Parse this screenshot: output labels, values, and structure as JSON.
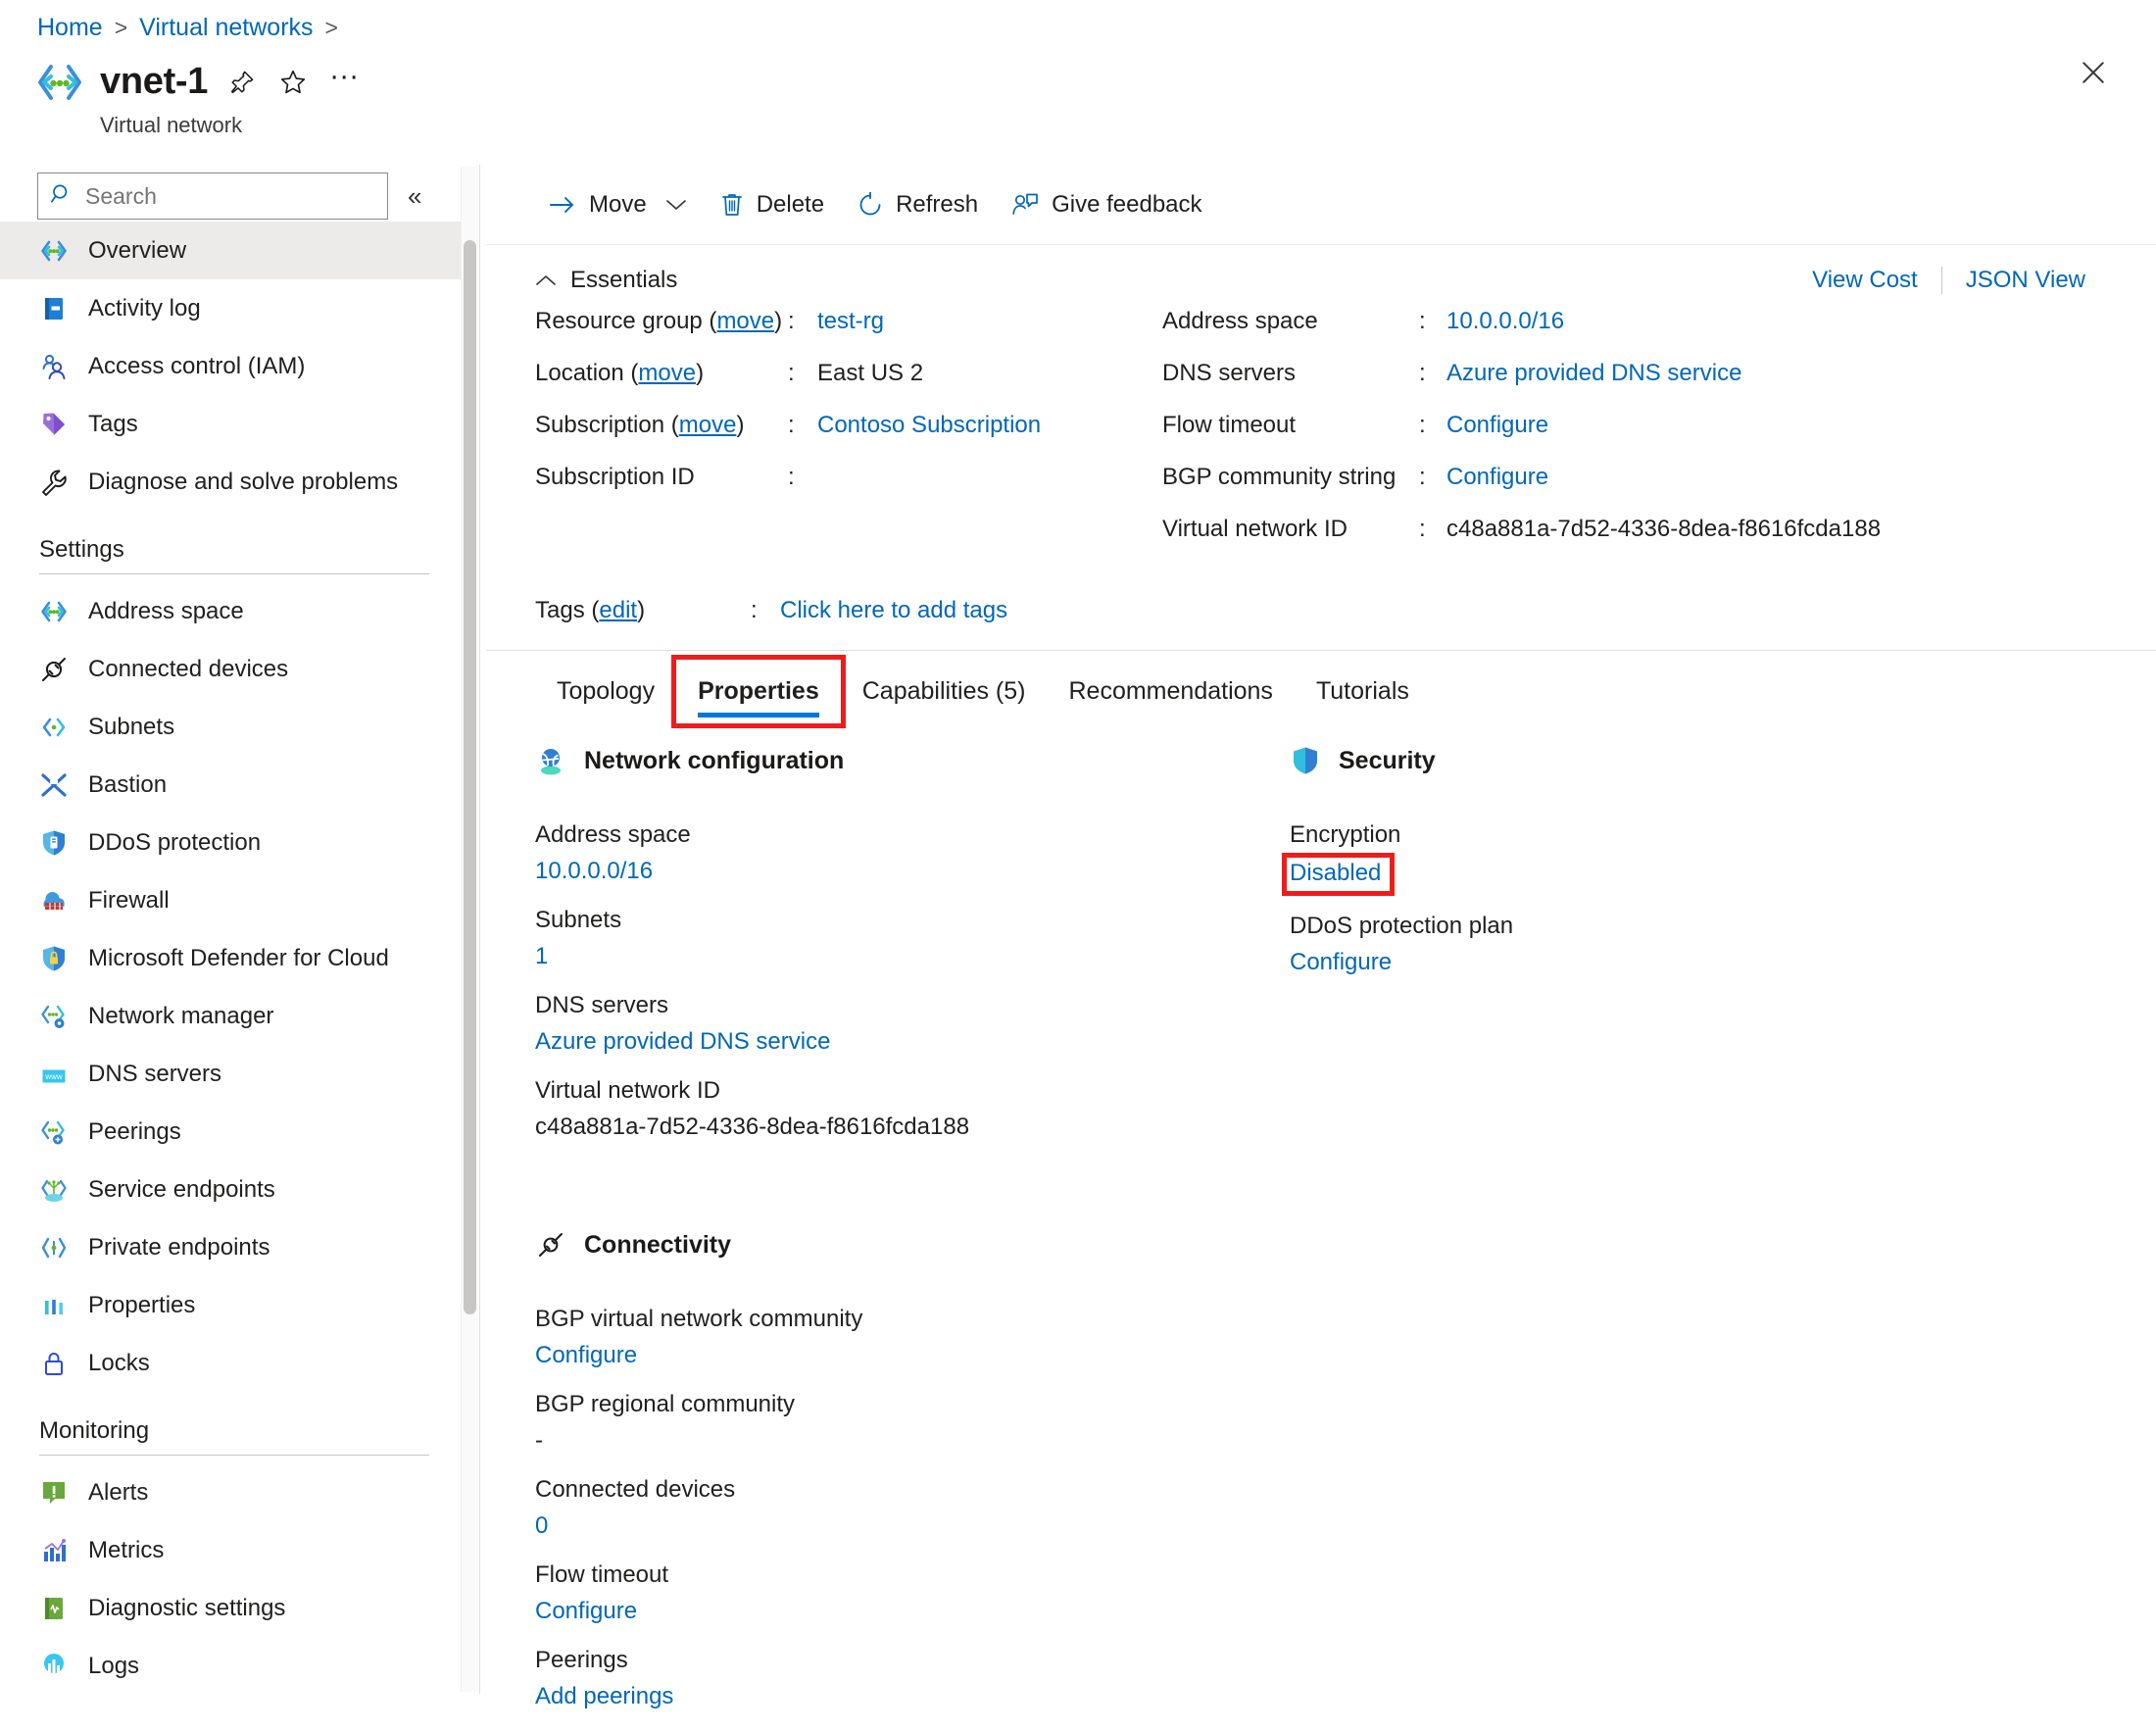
{
  "breadcrumb": {
    "items": [
      {
        "label": "Home",
        "sep": ">"
      },
      {
        "label": "Virtual networks",
        "sep": ">"
      }
    ]
  },
  "header": {
    "resource_name": "vnet-1",
    "resource_type": "Virtual network",
    "icon": "virtual-network-icon",
    "actions": {
      "pin": "pin-icon",
      "favorite": "star-icon",
      "more": "···",
      "close": "close-icon"
    }
  },
  "sidebar": {
    "search": {
      "placeholder": "Search",
      "value": "",
      "icon": "search-icon"
    },
    "collapse_label": "«",
    "items": [
      {
        "label": "Overview",
        "icon": "virtual-network-icon",
        "active": true,
        "kind": "item"
      },
      {
        "label": "Activity log",
        "icon": "activity-log-icon",
        "kind": "item"
      },
      {
        "label": "Access control (IAM)",
        "icon": "access-control-icon",
        "kind": "item"
      },
      {
        "label": "Tags",
        "icon": "tags-icon",
        "kind": "item"
      },
      {
        "label": "Diagnose and solve problems",
        "icon": "wrench-icon",
        "kind": "item"
      },
      {
        "label": "Settings",
        "kind": "group"
      },
      {
        "label": "Address space",
        "icon": "address-space-icon",
        "kind": "item"
      },
      {
        "label": "Connected devices",
        "icon": "connected-devices-icon",
        "kind": "item"
      },
      {
        "label": "Subnets",
        "icon": "subnets-icon",
        "kind": "item"
      },
      {
        "label": "Bastion",
        "icon": "bastion-icon",
        "kind": "item"
      },
      {
        "label": "DDoS protection",
        "icon": "ddos-shield-icon",
        "kind": "item"
      },
      {
        "label": "Firewall",
        "icon": "firewall-icon",
        "kind": "item"
      },
      {
        "label": "Microsoft Defender for Cloud",
        "icon": "defender-shield-icon",
        "kind": "item"
      },
      {
        "label": "Network manager",
        "icon": "network-manager-icon",
        "kind": "item"
      },
      {
        "label": "DNS servers",
        "icon": "dns-servers-icon",
        "kind": "item"
      },
      {
        "label": "Peerings",
        "icon": "peerings-icon",
        "kind": "item"
      },
      {
        "label": "Service endpoints",
        "icon": "service-endpoints-icon",
        "kind": "item"
      },
      {
        "label": "Private endpoints",
        "icon": "private-endpoints-icon",
        "kind": "item"
      },
      {
        "label": "Properties",
        "icon": "properties-icon",
        "kind": "item"
      },
      {
        "label": "Locks",
        "icon": "lock-icon",
        "kind": "item"
      },
      {
        "label": "Monitoring",
        "kind": "group"
      },
      {
        "label": "Alerts",
        "icon": "alerts-icon",
        "kind": "item"
      },
      {
        "label": "Metrics",
        "icon": "metrics-icon",
        "kind": "item"
      },
      {
        "label": "Diagnostic settings",
        "icon": "diagnostic-settings-icon",
        "kind": "item"
      },
      {
        "label": "Logs",
        "icon": "logs-icon",
        "kind": "item"
      }
    ]
  },
  "toolbar": {
    "move_label": "Move",
    "move_icon": "arrow-right-icon",
    "move_chevron": "chevron-down-icon",
    "delete_label": "Delete",
    "delete_icon": "trash-icon",
    "refresh_label": "Refresh",
    "refresh_icon": "refresh-icon",
    "feedback_label": "Give feedback",
    "feedback_icon": "feedback-icon"
  },
  "essentials": {
    "title": "Essentials",
    "collapse_icon": "chevron-up-icon",
    "view_cost_label": "View Cost",
    "json_view_label": "JSON View",
    "left": [
      {
        "label": "Resource group",
        "move": "move",
        "colon": ":",
        "value": "test-rg",
        "is_link": true
      },
      {
        "label": "Location",
        "move": "move",
        "colon": ":",
        "value": "East US 2",
        "is_link": false
      },
      {
        "label": "Subscription",
        "move": "move",
        "colon": ":",
        "value": "Contoso Subscription",
        "is_link": true
      },
      {
        "label": "Subscription ID",
        "move": "",
        "colon": ":",
        "value": "",
        "is_link": false
      }
    ],
    "right": [
      {
        "label": "Address space",
        "colon": ":",
        "value": "10.0.0.0/16",
        "is_link": true
      },
      {
        "label": "DNS servers",
        "colon": ":",
        "value": "Azure provided DNS service",
        "is_link": true
      },
      {
        "label": "Flow timeout",
        "colon": ":",
        "value": "Configure",
        "is_link": true
      },
      {
        "label": "BGP community string",
        "colon": ":",
        "value": "Configure",
        "is_link": true
      },
      {
        "label": "Virtual network ID",
        "colon": ":",
        "value": "c48a881a-7d52-4336-8dea-f8616fcda188",
        "is_link": false
      }
    ]
  },
  "tags": {
    "label": "Tags",
    "edit_label": "edit",
    "colon": ":",
    "value": "Click here to add tags"
  },
  "tabs": [
    {
      "label": "Topology",
      "selected": false,
      "highlighted": false
    },
    {
      "label": "Properties",
      "selected": true,
      "highlighted": true
    },
    {
      "label": "Capabilities (5)",
      "selected": false,
      "highlighted": false
    },
    {
      "label": "Recommendations",
      "selected": false,
      "highlighted": false
    },
    {
      "label": "Tutorials",
      "selected": false,
      "highlighted": false
    }
  ],
  "properties_tab": {
    "network_configuration": {
      "title": "Network configuration",
      "icon": "network-configuration-icon",
      "rows": [
        {
          "label": "Address space",
          "value": "10.0.0.0/16",
          "is_link": true
        },
        {
          "label": "Subnets",
          "value": "1",
          "is_link": true
        },
        {
          "label": "DNS servers",
          "value": "Azure provided DNS service",
          "is_link": true
        },
        {
          "label": "Virtual network ID",
          "value": "c48a881a-7d52-4336-8dea-f8616fcda188",
          "is_link": false
        }
      ]
    },
    "connectivity": {
      "title": "Connectivity",
      "icon": "connectivity-icon",
      "rows": [
        {
          "label": "BGP virtual network community",
          "value": "Configure",
          "is_link": true
        },
        {
          "label": "BGP regional community",
          "value": "-",
          "is_link": false
        },
        {
          "label": "Connected devices",
          "value": "0",
          "is_link": true
        },
        {
          "label": "Flow timeout",
          "value": "Configure",
          "is_link": true
        },
        {
          "label": "Peerings",
          "value": "Add peerings",
          "is_link": true
        }
      ]
    },
    "security": {
      "title": "Security",
      "icon": "security-shield-icon",
      "rows": [
        {
          "label": "Encryption",
          "value": "Disabled",
          "is_link": true,
          "highlighted": true
        },
        {
          "label": "DDoS protection plan",
          "value": "Configure",
          "is_link": true,
          "highlighted": false
        }
      ]
    }
  },
  "colors": {
    "link": "#0067b8",
    "accent": "#0078d4",
    "highlight": "#ef1c1c",
    "active_bg": "#edebe9"
  }
}
